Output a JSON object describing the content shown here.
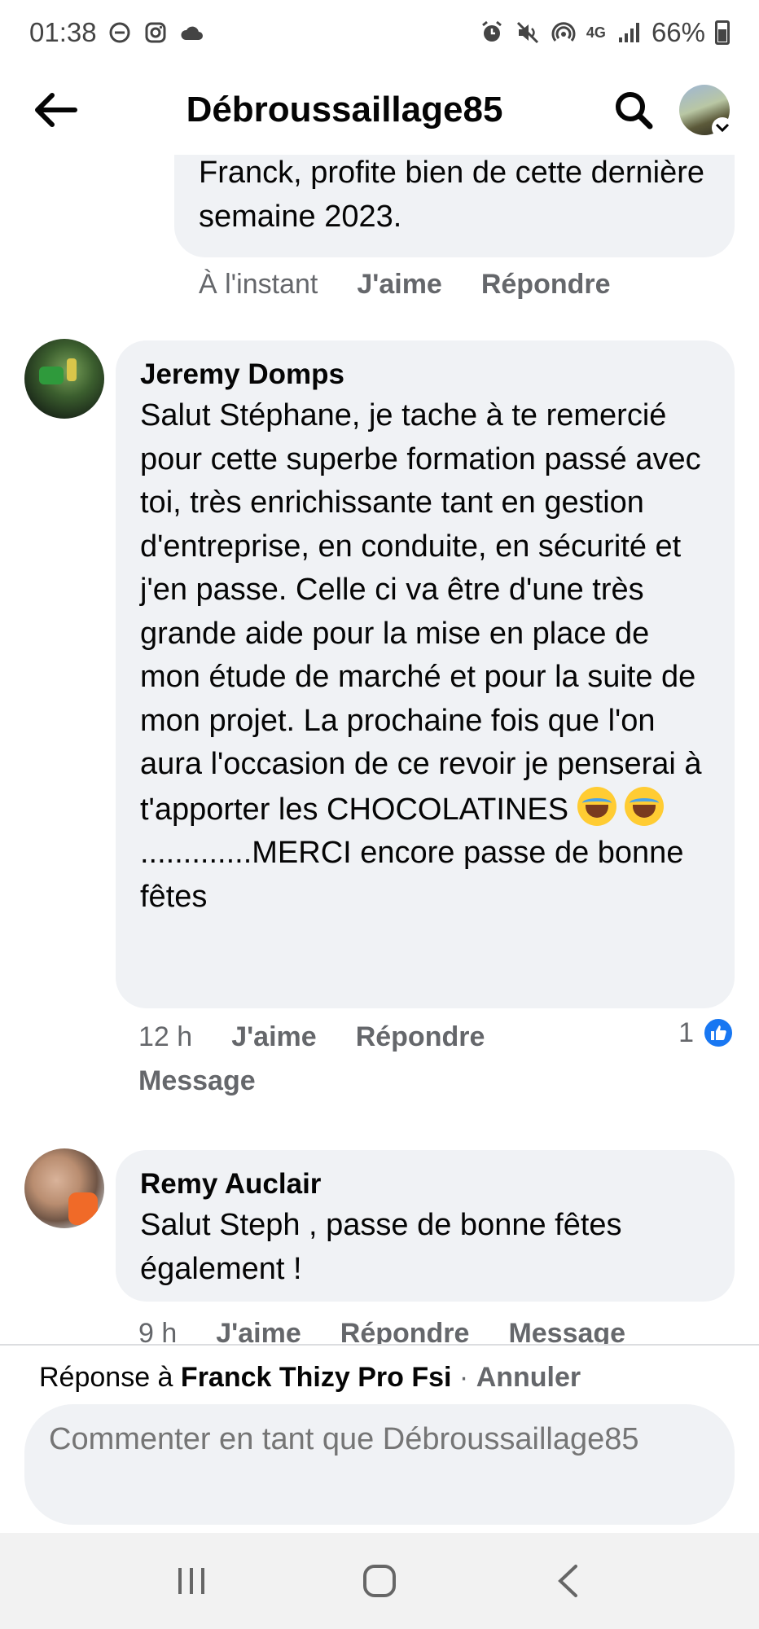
{
  "status_bar": {
    "time": "01:38",
    "network": "4G",
    "battery": "66%"
  },
  "header": {
    "title": "Débroussaillage85",
    "back_icon": "arrow-left-icon",
    "search_icon": "search-icon"
  },
  "comments": [
    {
      "author": "",
      "text": "Franck, profite bien de cette dernière semaine 2023.",
      "time": "À l'instant",
      "actions": [
        "J'aime",
        "Répondre"
      ]
    },
    {
      "author": "Jeremy Domps",
      "text_part1": "Salut Stéphane, je tache à te remercié pour cette superbe formation passé avec toi, très enrichissante tant en gestion d'entreprise, en conduite, en sécurité et j'en passe. Celle ci va être d'une très grande aide pour la mise en place de mon étude de marché et pour la suite de mon projet. La prochaine fois que l'on aura l'occasion de ce revoir je penserai à t'apporter les CHOCOLATINES",
      "text_part2": ".............MERCI encore passe de bonne fêtes",
      "time": "12 h",
      "actions": [
        "J'aime",
        "Répondre",
        "Message"
      ],
      "like_count": "1"
    },
    {
      "author": "Remy Auclair",
      "text": "Salut Steph , passe  de bonne fêtes également !",
      "time": "9 h",
      "actions": [
        "J'aime",
        "Répondre",
        "Message"
      ]
    }
  ],
  "reply_bar": {
    "prefix": "Réponse à",
    "target": "Franck Thizy Pro Fsi",
    "separator": "·",
    "cancel": "Annuler",
    "placeholder": "Commenter en tant que Débroussaillage85"
  },
  "colors": {
    "bubble": "#f0f2f5",
    "meta_text": "#65676b",
    "like_blue": "#1877f2"
  }
}
